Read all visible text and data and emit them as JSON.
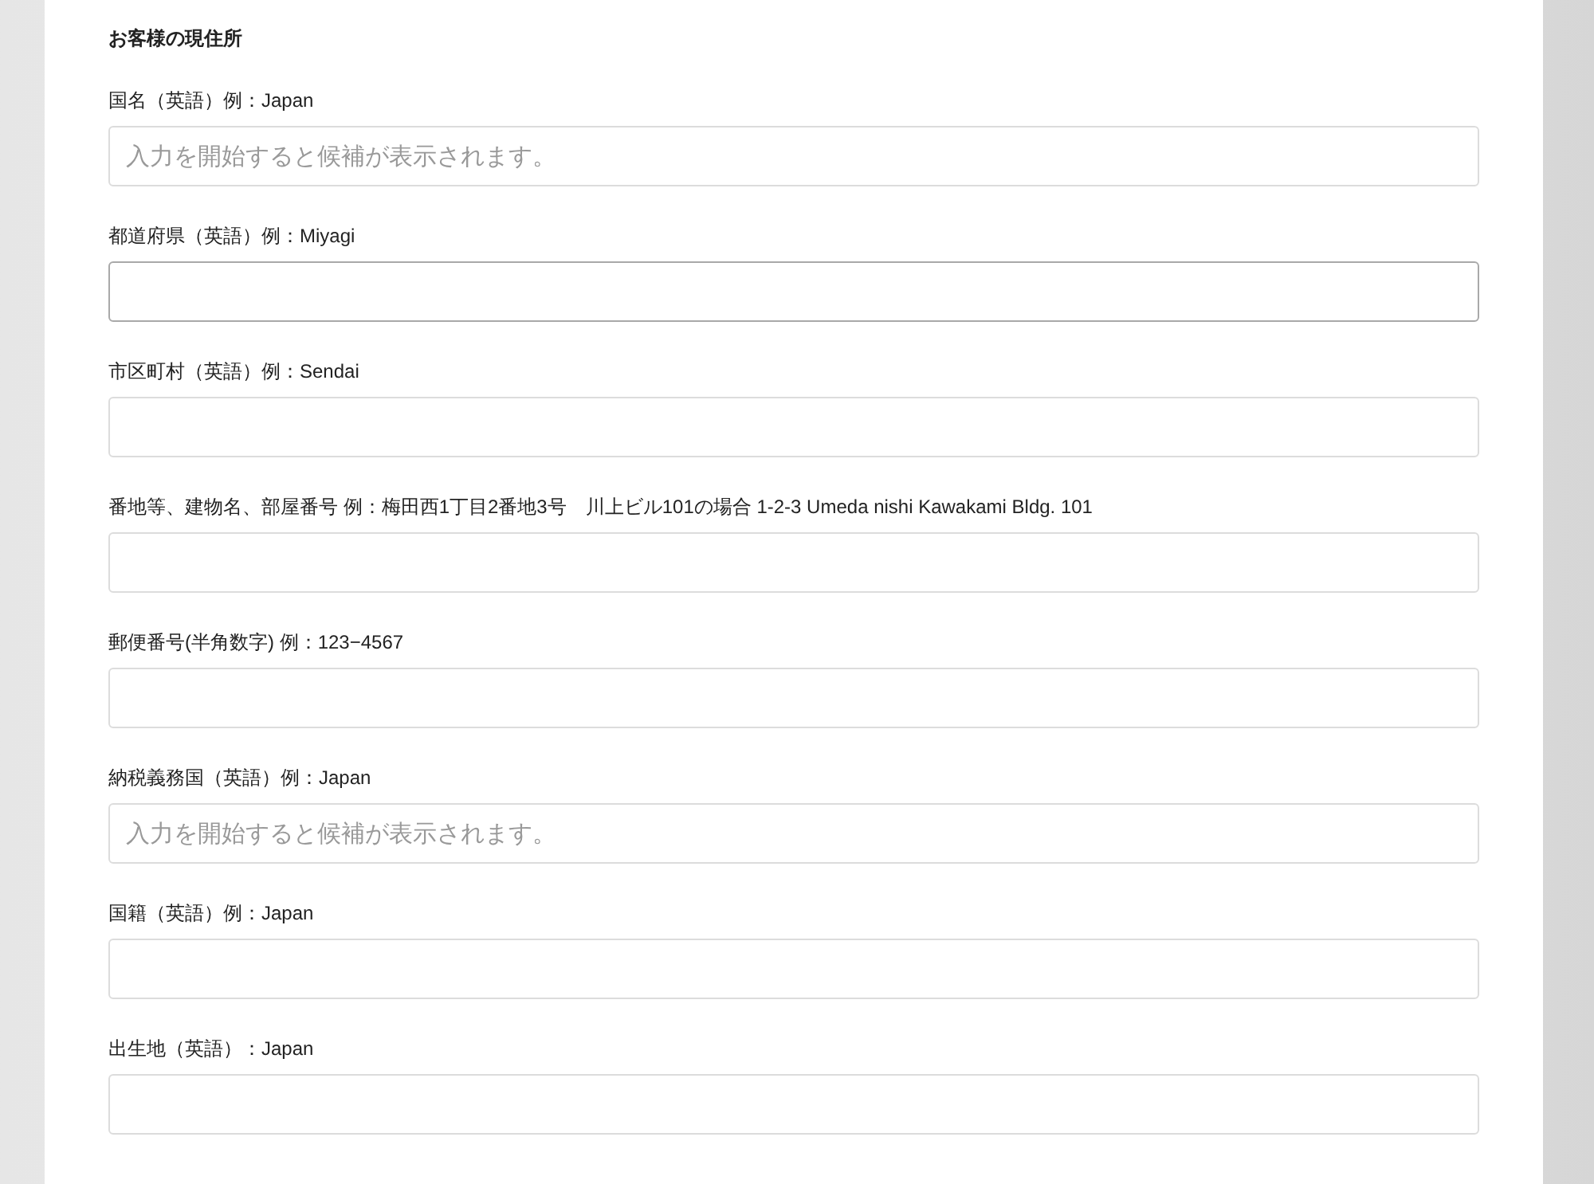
{
  "section_title": "お客様の現住所",
  "fields": [
    {
      "label": "国名（英語）例：Japan",
      "placeholder": "入力を開始すると候補が表示されます。",
      "focused": false
    },
    {
      "label": "都道府県（英語）例：Miyagi",
      "focused": true
    },
    {
      "label": "市区町村（英語）例：Sendai",
      "focused": false
    },
    {
      "label": "番地等、建物名、部屋番号 例：梅田西1丁目2番地3号　川上ビル101の場合 1-2-3 Umeda nishi Kawakami Bldg. 101",
      "focused": false
    },
    {
      "label": "郵便番号(半角数字) 例：123−4567",
      "focused": false
    },
    {
      "label": "納税義務国（英語）例：Japan",
      "placeholder": "入力を開始すると候補が表示されます。",
      "focused": false
    },
    {
      "label": "国籍（英語）例：Japan",
      "focused": false
    },
    {
      "label": "出生地（英語）：Japan",
      "focused": false
    }
  ]
}
